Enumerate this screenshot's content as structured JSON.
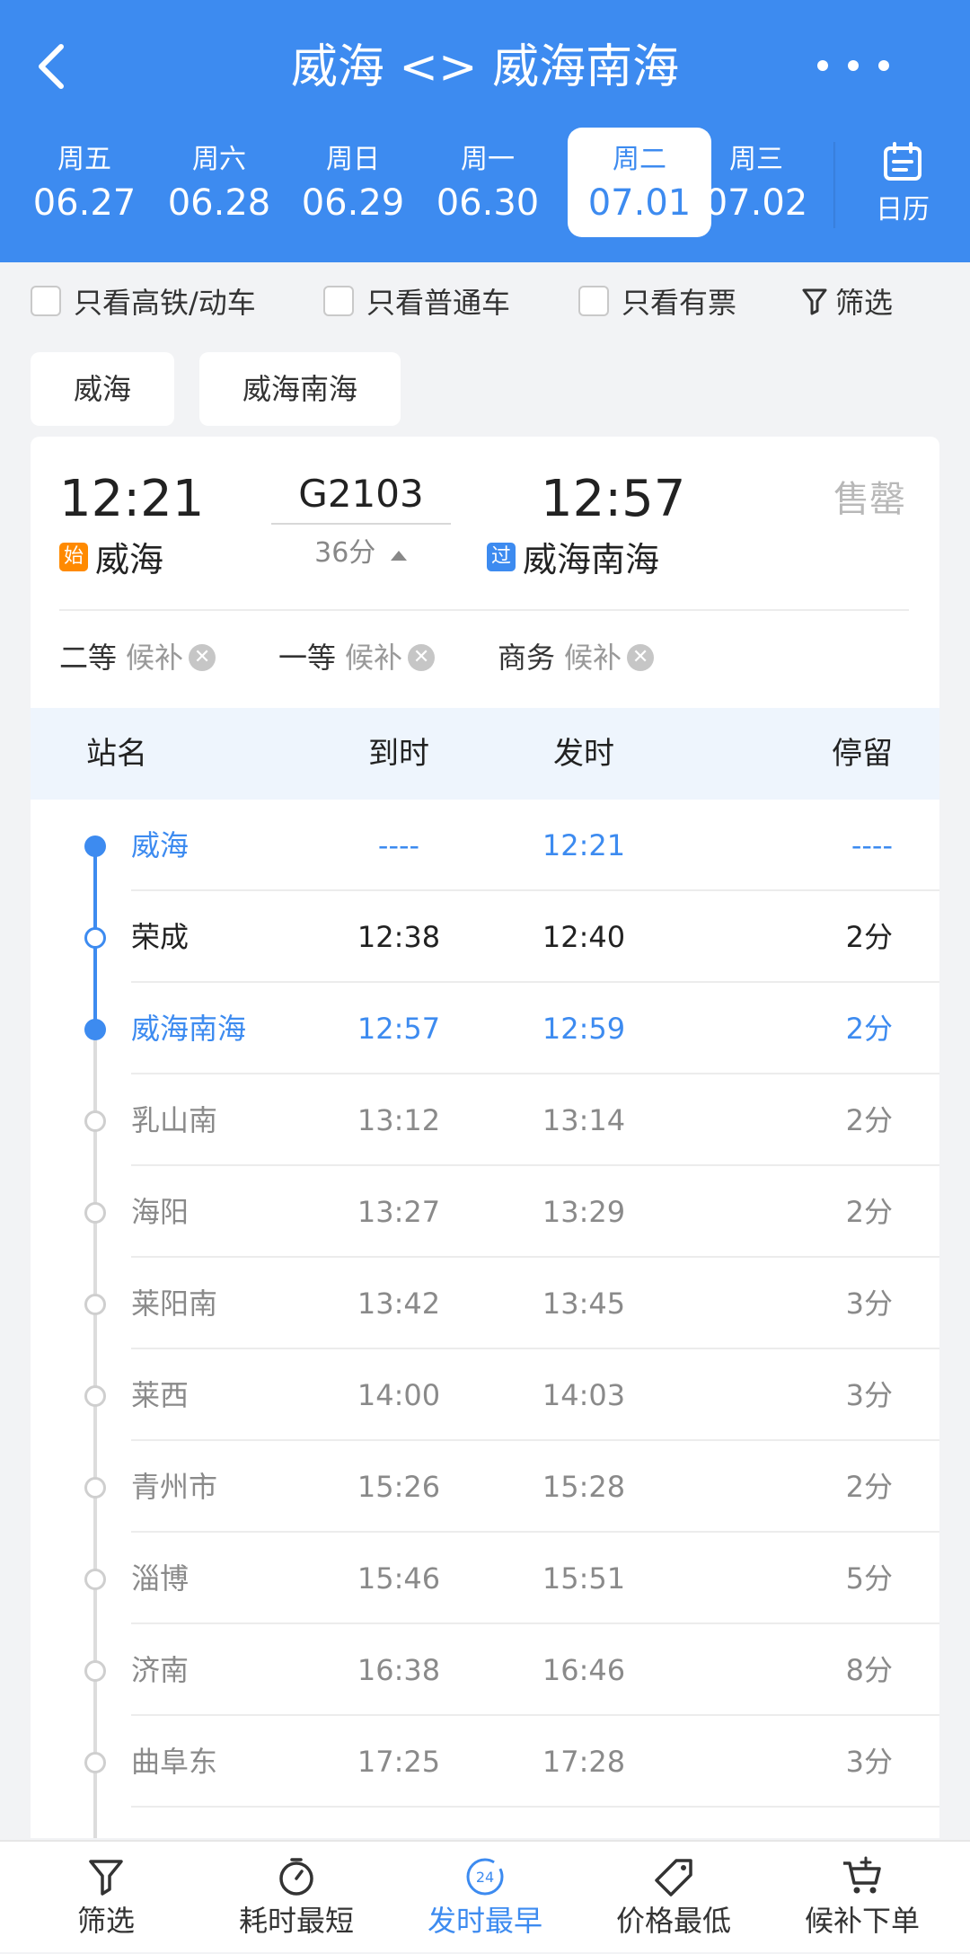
{
  "header": {
    "title": "威海 <> 威海南海"
  },
  "dates": [
    {
      "weekday": "周五",
      "date": "06.27"
    },
    {
      "weekday": "周六",
      "date": "06.28"
    },
    {
      "weekday": "周日",
      "date": "06.29"
    },
    {
      "weekday": "周一",
      "date": "06.30"
    },
    {
      "weekday": "周二",
      "date": "07.01"
    },
    {
      "weekday": "周三",
      "date": "07.02"
    }
  ],
  "selected_date_index": 4,
  "calendar_label": "日历",
  "filters": {
    "high_speed": "只看高铁/动车",
    "normal": "只看普通车",
    "available": "只看有票",
    "filter_label": "筛选"
  },
  "station_chips": [
    "威海",
    "威海南海"
  ],
  "train": {
    "dep_time": "12:21",
    "arr_time": "12:57",
    "number": "G2103",
    "duration": "36分",
    "dep_station": "威海",
    "arr_station": "威海南海",
    "start_tag": "始",
    "pass_tag": "过",
    "status": "售罄",
    "seats": [
      {
        "class": "二等",
        "status": "候补"
      },
      {
        "class": "一等",
        "status": "候补"
      },
      {
        "class": "商务",
        "status": "候补"
      }
    ]
  },
  "stops_header": {
    "station": "站名",
    "arrive": "到时",
    "depart": "发时",
    "stay": "停留"
  },
  "stops": [
    {
      "station": "威海",
      "arrive": "----",
      "depart": "12:21",
      "stay": "----"
    },
    {
      "station": "荣成",
      "arrive": "12:38",
      "depart": "12:40",
      "stay": "2分"
    },
    {
      "station": "威海南海",
      "arrive": "12:57",
      "depart": "12:59",
      "stay": "2分"
    },
    {
      "station": "乳山南",
      "arrive": "13:12",
      "depart": "13:14",
      "stay": "2分"
    },
    {
      "station": "海阳",
      "arrive": "13:27",
      "depart": "13:29",
      "stay": "2分"
    },
    {
      "station": "莱阳南",
      "arrive": "13:42",
      "depart": "13:45",
      "stay": "3分"
    },
    {
      "station": "莱西",
      "arrive": "14:00",
      "depart": "14:03",
      "stay": "3分"
    },
    {
      "station": "青州市",
      "arrive": "15:26",
      "depart": "15:28",
      "stay": "2分"
    },
    {
      "station": "淄博",
      "arrive": "15:46",
      "depart": "15:51",
      "stay": "5分"
    },
    {
      "station": "济南",
      "arrive": "16:38",
      "depart": "16:46",
      "stay": "8分"
    },
    {
      "station": "曲阜东",
      "arrive": "17:25",
      "depart": "17:28",
      "stay": "3分"
    }
  ],
  "bottom_tabs": [
    {
      "label": "筛选",
      "icon": "filter-icon"
    },
    {
      "label": "耗时最短",
      "icon": "timer-icon"
    },
    {
      "label": "发时最早",
      "icon": "clock-24-icon"
    },
    {
      "label": "价格最低",
      "icon": "price-tag-icon"
    },
    {
      "label": "候补下单",
      "icon": "cart-plus-icon"
    }
  ],
  "active_tab_index": 2,
  "colors": {
    "primary": "#3d8bf0",
    "start_tag": "#ff8a00",
    "muted": "#8a8a8a"
  }
}
